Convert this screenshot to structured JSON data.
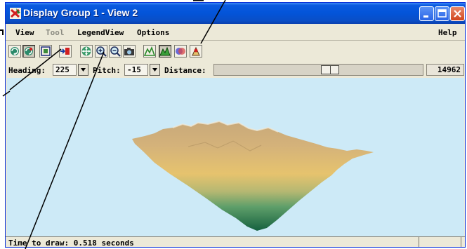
{
  "window": {
    "title": "Display Group 1 - View 2",
    "app_icon": "pencil-x-app-icon",
    "caption_buttons": [
      "minimize-icon",
      "maximize-icon",
      "close-icon"
    ]
  },
  "menubar": {
    "items": [
      {
        "label": "View",
        "enabled": true
      },
      {
        "label": "Tool",
        "enabled": false
      },
      {
        "label": "LegendView",
        "enabled": true
      },
      {
        "label": "Options",
        "enabled": true
      }
    ],
    "help": "Help"
  },
  "toolbar": {
    "buttons": [
      {
        "icon": "redraw-icon",
        "pressed": false
      },
      {
        "icon": "auto-redraw-icon",
        "pressed": true
      },
      {
        "icon": "full-view-icon",
        "pressed": false
      },
      {
        "icon": "add-layer-icon",
        "pressed": false
      },
      {
        "icon": "pan-icon",
        "pressed": false
      },
      {
        "icon": "zoom-in-icon",
        "pressed": false
      },
      {
        "icon": "zoom-out-icon",
        "pressed": false
      },
      {
        "icon": "snapshot-camera-icon",
        "pressed": false
      },
      {
        "icon": "terrain-icon",
        "pressed": false
      },
      {
        "icon": "terrain-highlight-icon",
        "pressed": true
      },
      {
        "icon": "stereo-view-icon",
        "pressed": false
      },
      {
        "icon": "viewer-position-icon",
        "pressed": false
      }
    ]
  },
  "controls": {
    "heading_label": "Heading:",
    "heading_value": "225",
    "pitch_label": "Pitch:",
    "pitch_value": "-15",
    "distance_label": "Distance:",
    "distance_value": "14962",
    "distance_slider_fraction": 0.56
  },
  "status": {
    "text": "Time to draw: 0.518 seconds"
  },
  "colors": {
    "titlebar": "#0354d8",
    "sky": "#cdeaf7",
    "terrain_high": "#c8a97a",
    "terrain_mid": "#e6c36e",
    "terrain_low": "#1f6e4e"
  }
}
